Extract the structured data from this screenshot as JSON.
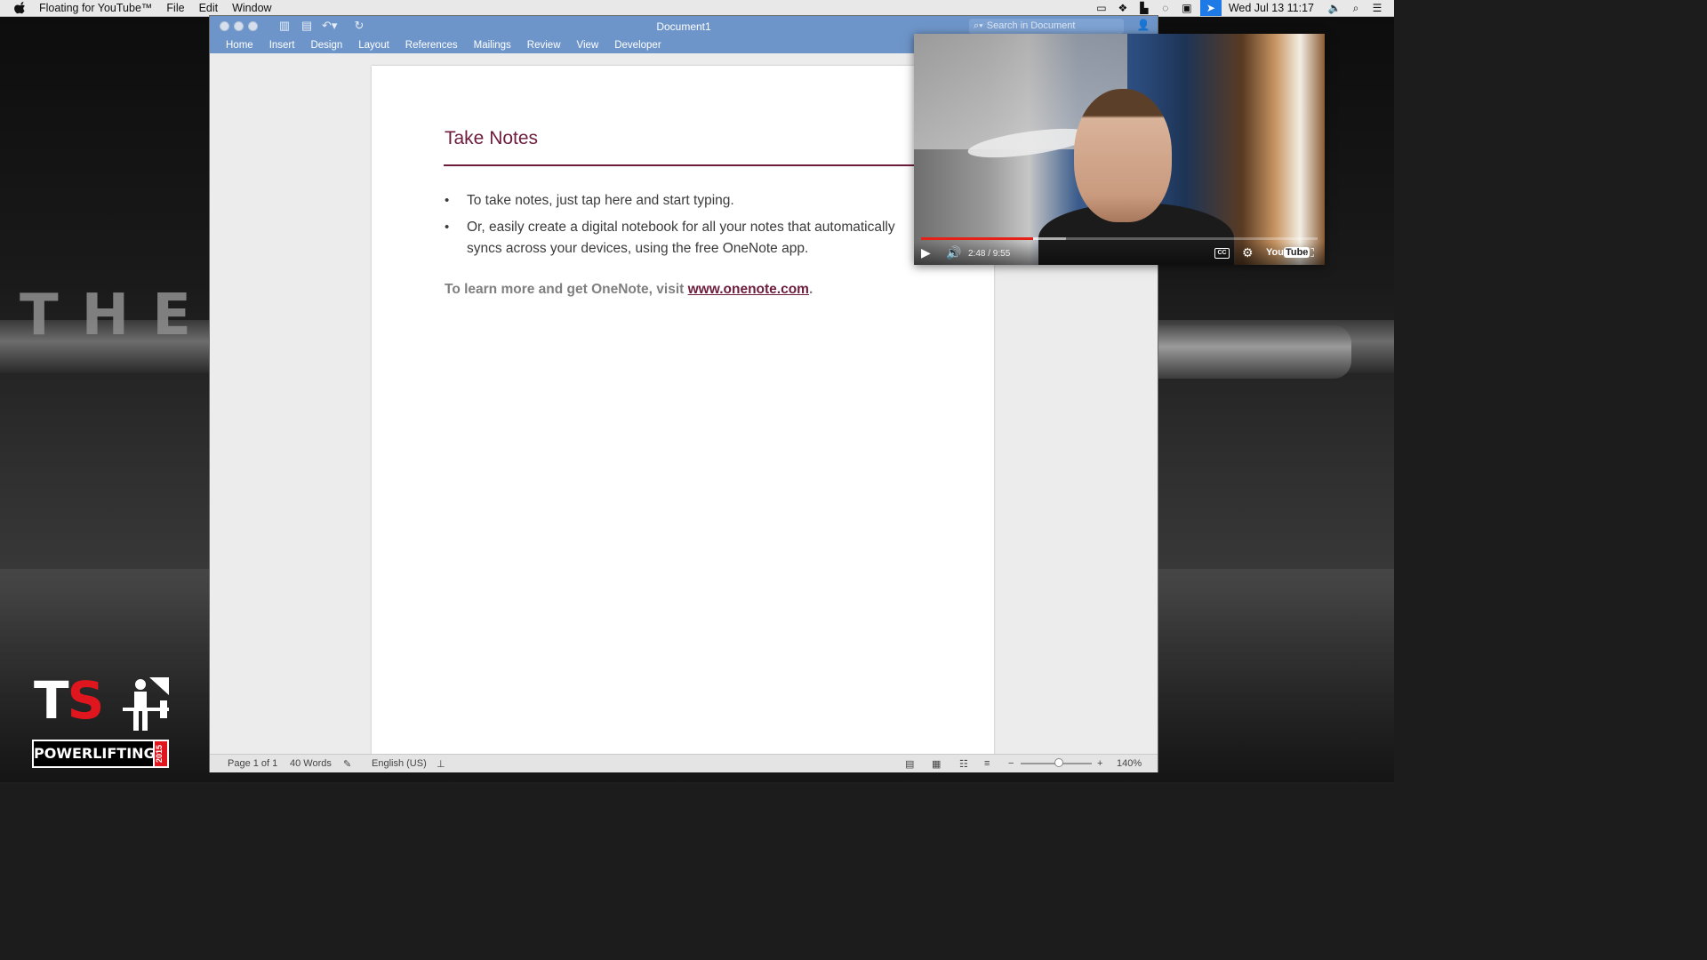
{
  "menubar": {
    "app_name": "Floating for YouTube™",
    "menus": [
      "File",
      "Edit",
      "Window"
    ],
    "clock": "Wed Jul 13  11:17"
  },
  "wallpaper": {
    "title_text": "THE S",
    "logo": {
      "letters_t": "T",
      "letters_s": "S",
      "word": "POWERLIFTING",
      "year": "2015"
    }
  },
  "word": {
    "document_title": "Document1",
    "search_placeholder": "Search in Document",
    "ribbon_tabs": [
      "Home",
      "Insert",
      "Design",
      "Layout",
      "References",
      "Mailings",
      "Review",
      "View",
      "Developer"
    ],
    "page": {
      "heading": "Take Notes",
      "bullets": [
        "To take notes, just tap here and start typing.",
        "Or, easily create a digital notebook for all your notes that automatically syncs across your devices, using the free OneNote app."
      ],
      "learn_prefix": "To learn more and get OneNote, visit ",
      "learn_link": "www.onenote.com",
      "learn_suffix": "."
    },
    "status": {
      "page": "Page 1 of 1",
      "words": "40 Words",
      "language": "English (US)",
      "zoom": "140%"
    }
  },
  "video": {
    "time": "2:48 / 9:55",
    "progress_fraction": 0.282,
    "buffered_fraction": 0.365,
    "youtube_label": "You",
    "youtube_label_box": "Tube"
  },
  "colors": {
    "accent_word": "#6e95c9",
    "heading": "#6d1c3c",
    "youtube_red": "#e62117"
  }
}
